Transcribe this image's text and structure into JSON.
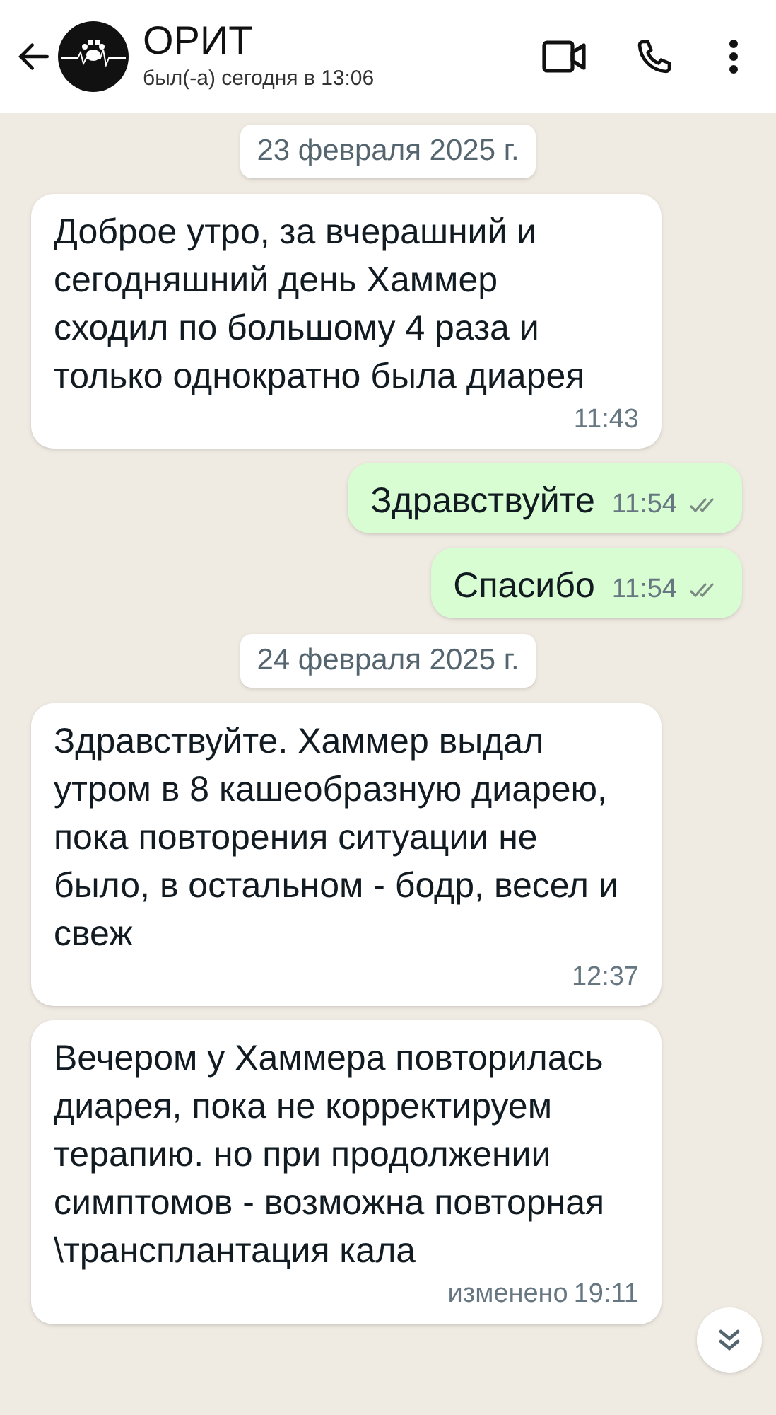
{
  "header": {
    "name": "ОРИТ",
    "status": "был(-а) сегодня в 13:06"
  },
  "items": [
    {
      "kind": "date",
      "text": "23 февраля 2025 г."
    },
    {
      "kind": "incoming",
      "text": "Доброе утро, за вчерашний и сегодняшний день Хаммер сходил по большому 4 раза и только однократно была диарея",
      "time": "11:43"
    },
    {
      "kind": "outgoing",
      "text": "Здравствуйте",
      "time": "11:54",
      "read": false
    },
    {
      "kind": "outgoing",
      "text": "Спасибо",
      "time": "11:54",
      "read": false
    },
    {
      "kind": "date",
      "text": "24 февраля 2025 г."
    },
    {
      "kind": "incoming",
      "text": "Здравствуйте. Хаммер выдал утром в 8 кашеобразную диарею, пока повторения ситуации не было, в остальном - бодр, весел и свеж",
      "time": "12:37"
    },
    {
      "kind": "incoming",
      "text": "Вечером у Хаммера повторилась диарея, пока не корректируем терапию. но при продолжении симптомов - возможна повторная \\трансплантация кала",
      "time": "19:11",
      "edited": "изменено"
    }
  ]
}
